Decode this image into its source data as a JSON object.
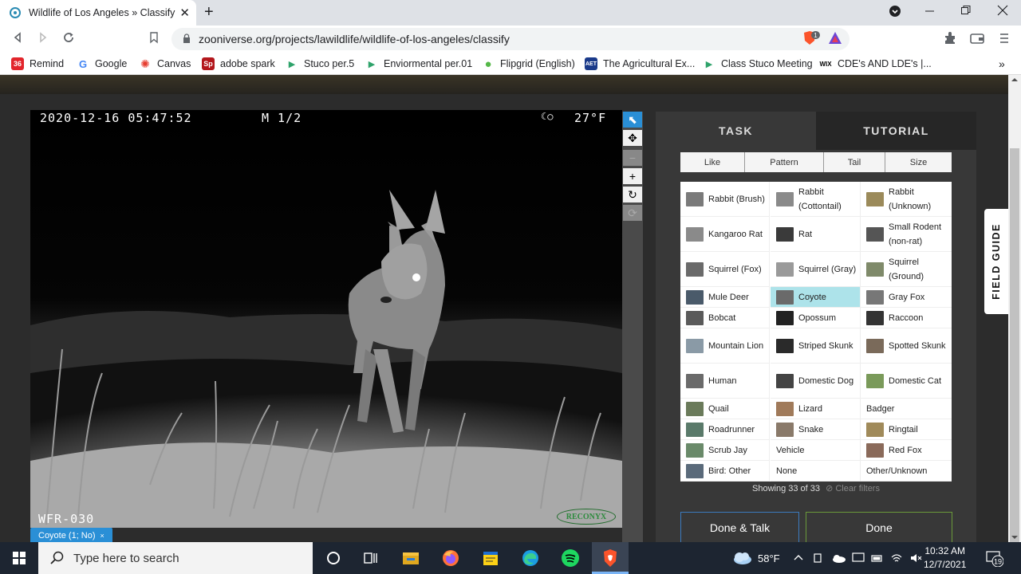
{
  "browser": {
    "tab_title": "Wildlife of Los Angeles » Classify",
    "tab_close": "✕",
    "new_tab": "+",
    "url": "zooniverse.org/projects/lawildlife/wildlife-of-los-angeles/classify",
    "brave_badge": "1",
    "bookmarks": [
      {
        "label": "Remind",
        "icon": "36",
        "color": "#e2252b"
      },
      {
        "label": "Google",
        "icon": "G",
        "color": "#4285f4"
      },
      {
        "label": "Canvas",
        "icon": "✺",
        "color": "#e63e30"
      },
      {
        "label": "adobe spark",
        "icon": "Sp",
        "color": "#e3262b"
      },
      {
        "label": "Stuco per.5",
        "icon": "▶",
        "color": "#2fa36b"
      },
      {
        "label": "Enviormental per.01",
        "icon": "▶",
        "color": "#2fa36b"
      },
      {
        "label": "Flipgrid (English)",
        "icon": "●",
        "color": "#55b848"
      },
      {
        "label": "The Agricultural Ex...",
        "icon": "AET",
        "color": "#1a3a8a"
      },
      {
        "label": "Class Stuco Meeting",
        "icon": "▶",
        "color": "#2fa36b"
      },
      {
        "label": "CDE's AND LDE's |...",
        "icon": "WIX",
        "color": "#000000"
      }
    ],
    "more_bookmarks": "»"
  },
  "subject": {
    "timestamp": "2020-12-16 05:47:52",
    "frame": "M 1/2",
    "temperature": "27°F",
    "moon_icon": "☾○",
    "camera_id": "WFR-030",
    "brand": "RECONYX",
    "annotation_tag": "Coyote (1; No)",
    "annotation_tag_close": "×"
  },
  "tools": {
    "pointer": "⬉",
    "move": "✥",
    "zoom_out": "−",
    "zoom_in": "+",
    "rotate": "↻",
    "reset": "⟳"
  },
  "panel": {
    "tabs": [
      "TASK",
      "TUTORIAL"
    ],
    "filters": [
      "Like",
      "Pattern",
      "Tail",
      "Size"
    ],
    "choices": [
      {
        "label": "Rabbit (Brush)",
        "thumb": "#7a7a7a"
      },
      {
        "label": "Rabbit (Cottontail)",
        "thumb": "#8a8a8a"
      },
      {
        "label": "Rabbit (Unknown)",
        "thumb": "#9b8a5a"
      },
      {
        "label": "Kangaroo Rat",
        "thumb": "#8a8a8a"
      },
      {
        "label": "Rat",
        "thumb": "#3a3a3a"
      },
      {
        "label": "Small Rodent (non-rat)",
        "thumb": "#555555"
      },
      {
        "label": "Squirrel (Fox)",
        "thumb": "#6a6a6a"
      },
      {
        "label": "Squirrel (Gray)",
        "thumb": "#9a9a9a"
      },
      {
        "label": "Squirrel (Ground)",
        "thumb": "#7f8a6a"
      },
      {
        "label": "Mule Deer",
        "thumb": "#4a5a6a"
      },
      {
        "label": "Coyote",
        "thumb": "#6a6a6a"
      },
      {
        "label": "Gray Fox",
        "thumb": "#777777"
      },
      {
        "label": "Bobcat",
        "thumb": "#5a5a5a"
      },
      {
        "label": "Opossum",
        "thumb": "#222222"
      },
      {
        "label": "Raccoon",
        "thumb": "#333333"
      },
      {
        "label": "Mountain Lion",
        "thumb": "#8a9aa6"
      },
      {
        "label": "Striped Skunk",
        "thumb": "#2a2a2a"
      },
      {
        "label": "Spotted Skunk",
        "thumb": "#7a6a5a"
      },
      {
        "label": "Human",
        "thumb": "#6a6a6a"
      },
      {
        "label": "Domestic Dog",
        "thumb": "#444444"
      },
      {
        "label": "Domestic Cat",
        "thumb": "#7a9a5a"
      },
      {
        "label": "Quail",
        "thumb": "#6a7a5a"
      },
      {
        "label": "Lizard",
        "thumb": "#a07a5a"
      },
      {
        "label": "Badger",
        "thumb": ""
      },
      {
        "label": "Roadrunner",
        "thumb": "#5a7a6a"
      },
      {
        "label": "Snake",
        "thumb": "#8a7a6a"
      },
      {
        "label": "Ringtail",
        "thumb": "#a08a5a"
      },
      {
        "label": "Scrub Jay",
        "thumb": "#6a8a6a"
      },
      {
        "label": "Vehicle",
        "thumb": ""
      },
      {
        "label": "Red Fox",
        "thumb": "#8a6a5a"
      },
      {
        "label": "Bird: Other",
        "thumb": "#5a6a7a"
      },
      {
        "label": "None",
        "thumb": ""
      },
      {
        "label": "Other/Unknown",
        "thumb": ""
      }
    ],
    "selected": "Coyote",
    "showing": "Showing 33 of 33",
    "clear_filters": "⊘ Clear filters",
    "done_talk": "Done & Talk",
    "done": "Done",
    "field_guide": "FIELD GUIDE"
  },
  "taskbar": {
    "search_placeholder": "Type here to search",
    "weather": "58°F",
    "time": "10:32 AM",
    "date": "12/7/2021",
    "notifications": "19"
  },
  "colors": {
    "accent": "#2a8fd6",
    "selected_choice": "#ade3ea",
    "panel": "#383838",
    "taskbar": "#1d2531"
  }
}
